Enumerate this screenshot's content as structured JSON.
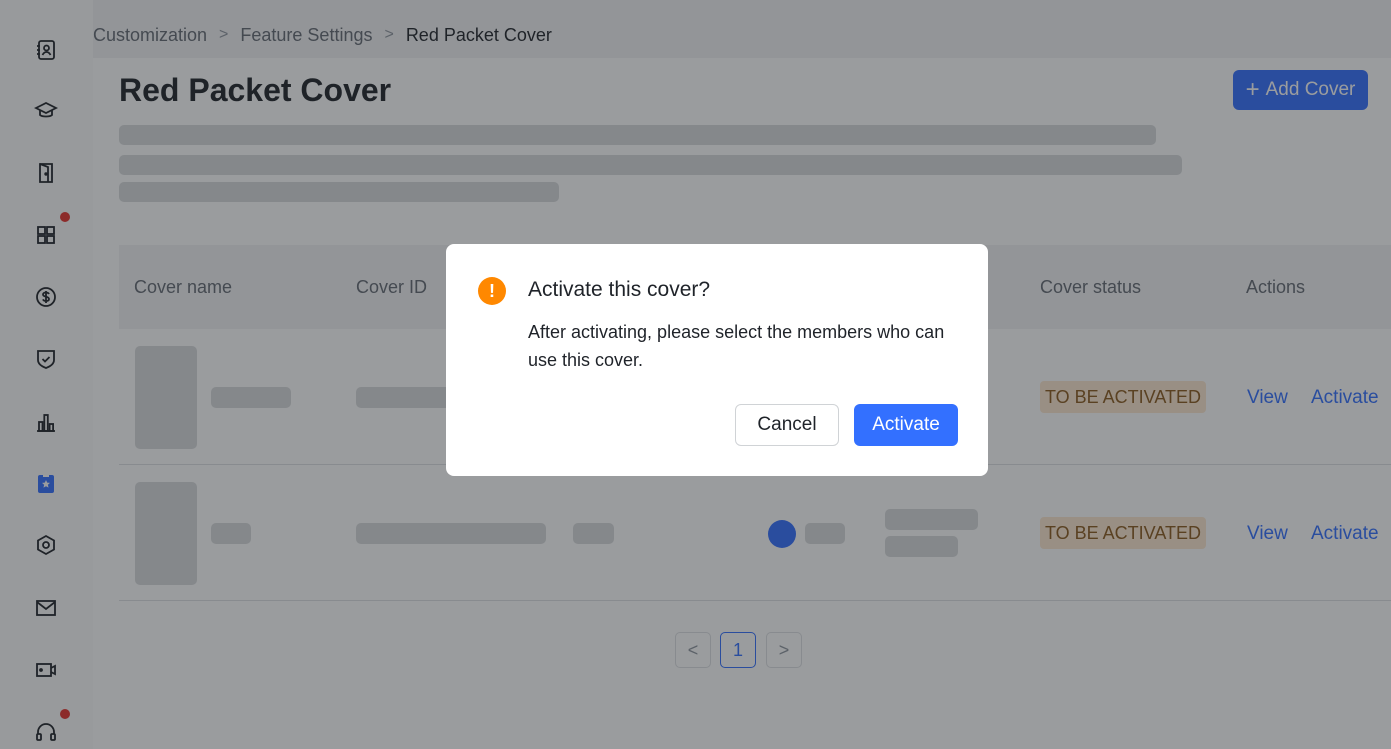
{
  "breadcrumb": {
    "items": [
      "Customization",
      "Feature Settings",
      "Red Packet Cover"
    ],
    "separator": ">"
  },
  "page": {
    "title": "Red Packet Cover",
    "add_button_label": "Add Cover",
    "add_button_icon": "+"
  },
  "table": {
    "headers": [
      "Cover name",
      "Cover ID",
      "Cover status",
      "Actions"
    ],
    "rows": [
      {
        "status": "TO BE ACTIVATED",
        "actions": [
          "View",
          "Activate"
        ]
      },
      {
        "status": "TO BE ACTIVATED",
        "actions": [
          "View",
          "Activate"
        ]
      }
    ]
  },
  "pagination": {
    "prev": "<",
    "current": "1",
    "next": ">"
  },
  "dialog": {
    "icon": "!",
    "title": "Activate this cover?",
    "body": "After activating, please select the members who can use this cover.",
    "cancel_label": "Cancel",
    "confirm_label": "Activate"
  },
  "colors": {
    "primary": "#3370ff",
    "warning": "#ff8800",
    "badge_bg": "#fde8d0",
    "notification_dot": "#e5322d"
  },
  "sidebar": {
    "icons": [
      "contacts-icon",
      "learning-cap-icon",
      "door-icon",
      "apps-grid-icon",
      "dollar-icon",
      "shield-check-icon",
      "bar-chart-icon",
      "badge-star-icon",
      "hexagon-settings-icon",
      "mail-icon",
      "video-icon",
      "headset-icon"
    ]
  }
}
